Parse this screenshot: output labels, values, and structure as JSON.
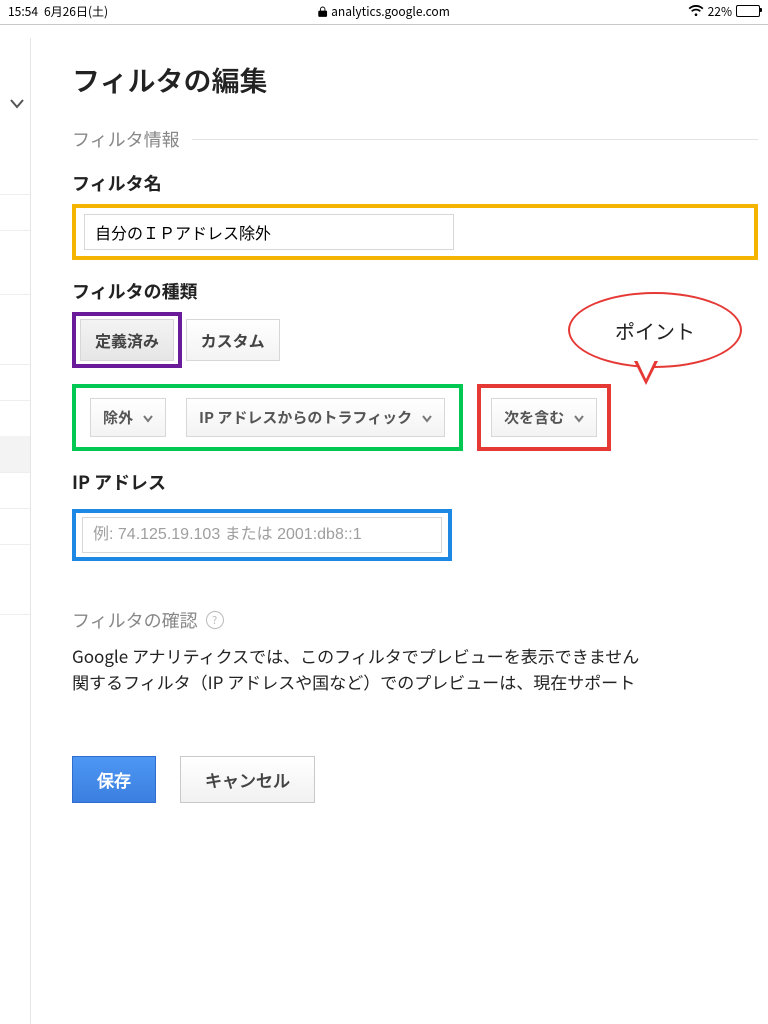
{
  "status_bar": {
    "time": "15:54",
    "date": "6月26日(土)",
    "url": "analytics.google.com",
    "battery_percent": "22%",
    "battery_fill_pct": 22
  },
  "page": {
    "title": "フィルタの編集",
    "section_info_label": "フィルタ情報"
  },
  "filter_name": {
    "label": "フィルタ名",
    "value": "自分のＩＰアドレス除外"
  },
  "filter_type": {
    "label": "フィルタの種類",
    "tabs": {
      "predefined": "定義済み",
      "custom": "カスタム"
    },
    "selects": {
      "mode": "除外",
      "source": "IP アドレスからのトラフィック",
      "match": "次を含む"
    }
  },
  "ip_address": {
    "label": "IP アドレス",
    "placeholder": "例: 74.125.19.103 または 2001:db8::1"
  },
  "verify": {
    "label": "フィルタの確認",
    "body_line1": "Google アナリティクスでは、このフィルタでプレビューを表示できません",
    "body_line2": "関するフィルタ（IP アドレスや国など）でのプレビューは、現在サポート"
  },
  "annotations": {
    "point_bubble": "ポイント"
  },
  "buttons": {
    "save": "保存",
    "cancel": "キャンセル"
  },
  "colors": {
    "yellow": "#f4b400",
    "purple": "#6a1b9a",
    "green": "#00c853",
    "red": "#e53935",
    "blue": "#1e88e5",
    "primary": "#3b7fe0"
  }
}
